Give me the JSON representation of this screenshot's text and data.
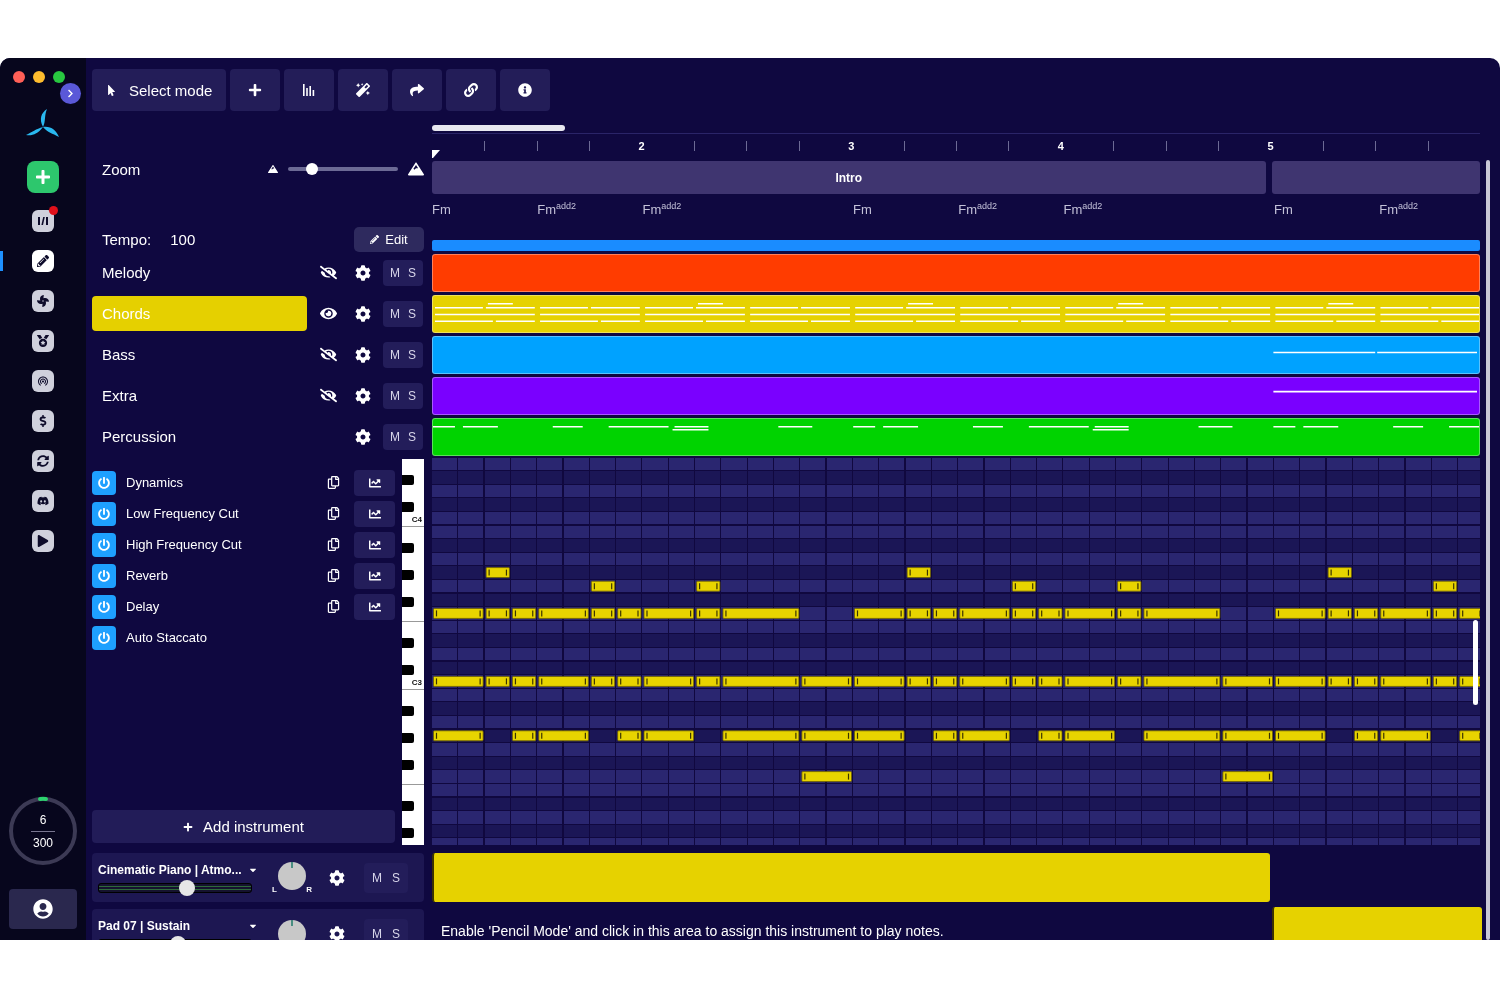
{
  "rail": {
    "items": [
      {
        "selected": false,
        "badge": true
      },
      {
        "selected": true,
        "badge": false
      },
      {
        "selected": false,
        "badge": false
      },
      {
        "selected": false,
        "badge": false
      },
      {
        "selected": false,
        "badge": false
      },
      {
        "selected": false,
        "badge": false
      },
      {
        "selected": false,
        "badge": false
      },
      {
        "selected": false,
        "badge": false
      },
      {
        "selected": false,
        "badge": false
      }
    ]
  },
  "usage": {
    "count": "6",
    "limit": "300"
  },
  "toolbar": {
    "mode": "Select mode"
  },
  "zoom": {
    "label": "Zoom",
    "level": 0.22
  },
  "tempo": {
    "label": "Tempo:",
    "value": "100",
    "edit": "Edit"
  },
  "tracks": [
    {
      "name": "Melody",
      "selected": false,
      "kind": "pitched",
      "visible": false,
      "color": "#ff3c00",
      "mute": "M",
      "solo": "S"
    },
    {
      "name": "Chords",
      "selected": true,
      "kind": "pitched",
      "visible": true,
      "color": "#e6d200",
      "mute": "M",
      "solo": "S"
    },
    {
      "name": "Bass",
      "selected": false,
      "kind": "pitched",
      "visible": false,
      "color": "#00a2ff",
      "mute": "M",
      "solo": "S"
    },
    {
      "name": "Extra",
      "selected": false,
      "kind": "pitched",
      "visible": false,
      "color": "#7a00ff",
      "mute": "M",
      "solo": "S"
    },
    {
      "name": "Percussion",
      "selected": false,
      "kind": "drums",
      "color": "#00d300",
      "mute": "M",
      "solo": "S"
    }
  ],
  "effects": [
    {
      "name": "Dynamics",
      "on": true,
      "kind": "automatable"
    },
    {
      "name": "Low Frequency Cut",
      "on": true,
      "kind": "automatable"
    },
    {
      "name": "High Frequency Cut",
      "on": true,
      "kind": "automatable"
    },
    {
      "name": "Reverb",
      "on": true,
      "kind": "automatable"
    },
    {
      "name": "Delay",
      "on": true,
      "kind": "automatable"
    },
    {
      "name": "Auto Staccato",
      "on": true,
      "kind": "toggle"
    }
  ],
  "keyboard": {
    "labels": [
      "C4",
      "C3"
    ]
  },
  "add_instrument": "Add instrument",
  "instruments": [
    {
      "name": "Cinematic Piano | Atmo...",
      "level": 0.58,
      "pan_left": "L",
      "pan_right": "R",
      "mute": "M",
      "solo": "S"
    },
    {
      "name": "Pad 07 | Sustain",
      "level": 0.52,
      "mute": "M",
      "solo": "S"
    }
  ],
  "timeline": {
    "bars": [
      "2",
      "3",
      "4",
      "5"
    ],
    "sections": [
      {
        "label": "Intro",
        "kind": "long"
      },
      {
        "kind": "short"
      }
    ],
    "chords": [
      {
        "text": "Fm",
        "kind": "half"
      },
      {
        "text": "Fm$^{add2}$",
        "kind": "half"
      },
      {
        "text": "Fm$^{add2}$",
        "kind": "whole"
      },
      {
        "text": "Fm",
        "kind": "half"
      },
      {
        "text": "Fm$^{add2}$",
        "kind": "half"
      },
      {
        "text": "Fm$^{add2}$",
        "kind": "whole"
      },
      {
        "text": "Fm",
        "kind": "half"
      },
      {
        "text": "Fm$^{add2}$",
        "kind": "half"
      }
    ]
  },
  "hint": "Enable 'Pencil Mode' and click in this area to assign this instrument to play notes."
}
